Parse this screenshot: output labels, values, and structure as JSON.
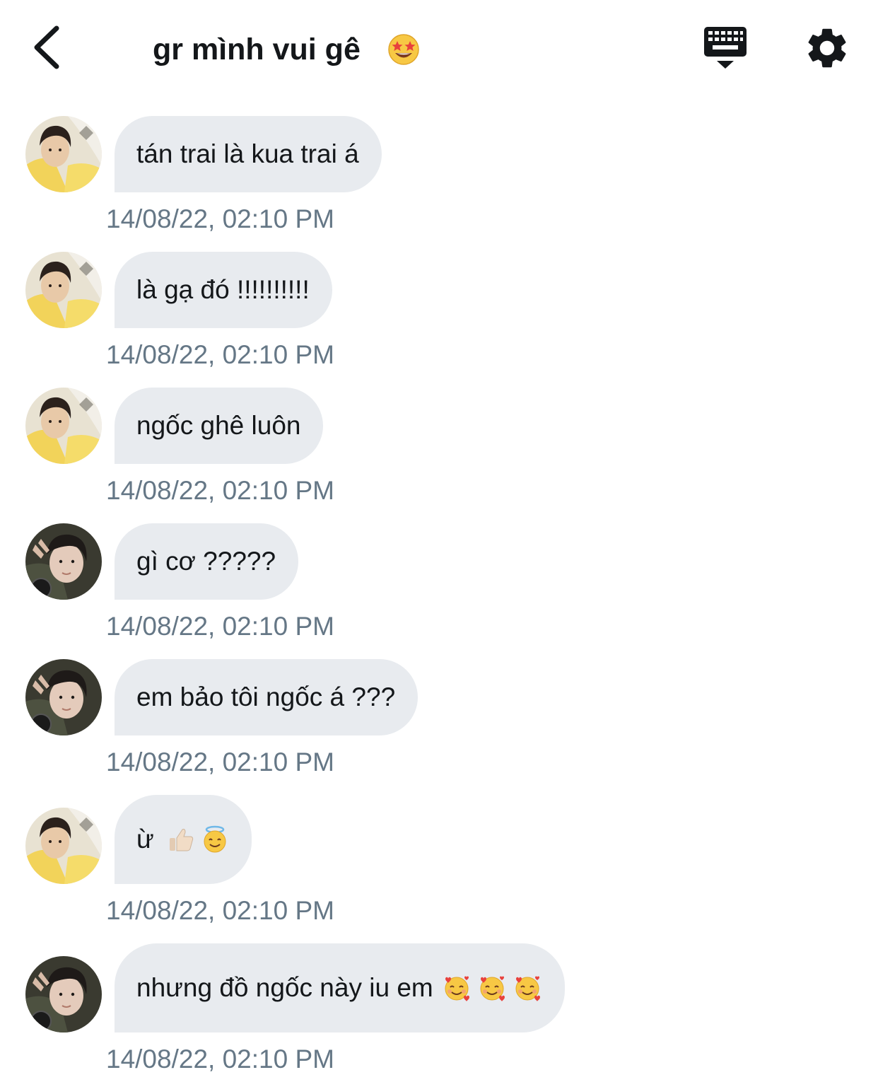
{
  "header": {
    "back_icon": "chevron-left-icon",
    "title": "gr mình vui gê",
    "title_emoji": "star-struck-emoji",
    "keyboard_icon": "keyboard-dismiss-icon",
    "settings_icon": "gear-icon"
  },
  "colors": {
    "bubble": "#e8ebef",
    "timestamp": "#657786",
    "text": "#14171a"
  },
  "messages": [
    {
      "sender": "avatar-a",
      "text": "tán trai là kua trai á",
      "emojis": [],
      "time": "14/08/22, 02:10 PM"
    },
    {
      "sender": "avatar-a",
      "text": "là gạ đó !!!!!!!!!!",
      "emojis": [],
      "time": "14/08/22, 02:10 PM"
    },
    {
      "sender": "avatar-a",
      "text": "ngốc ghê luôn",
      "emojis": [],
      "time": "14/08/22, 02:10 PM"
    },
    {
      "sender": "avatar-b",
      "text": "gì cơ ?????",
      "emojis": [],
      "time": "14/08/22, 02:10 PM"
    },
    {
      "sender": "avatar-b",
      "text": "em bảo tôi ngốc á ???",
      "emojis": [],
      "time": "14/08/22, 02:10 PM"
    },
    {
      "sender": "avatar-a",
      "text": "ừ",
      "emojis": [
        "thumbs-up-emoji",
        "halo-face-emoji"
      ],
      "time": "14/08/22, 02:10 PM"
    },
    {
      "sender": "avatar-b",
      "text": "nhưng đồ ngốc này iu em",
      "emojis": [
        "smiling-hearts-emoji",
        "smiling-hearts-emoji",
        "smiling-hearts-emoji"
      ],
      "time": "14/08/22, 02:10 PM"
    }
  ]
}
